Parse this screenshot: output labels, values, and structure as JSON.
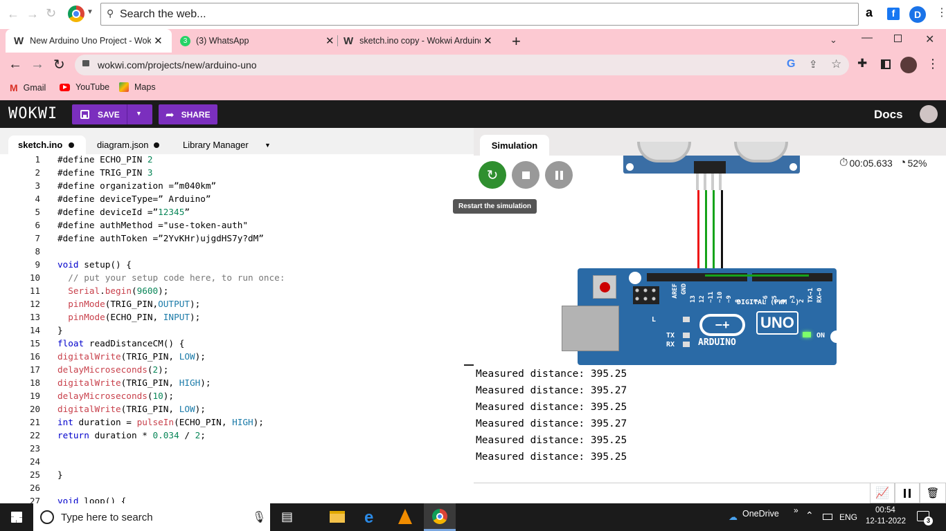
{
  "browser": {
    "search_placeholder": "Search the web...",
    "tabs": [
      {
        "title": "New Arduino Uno Project - Wokwi",
        "icon": "wokwi-icon"
      },
      {
        "title": "(3) WhatsApp",
        "icon": "whatsapp-icon"
      },
      {
        "title": "sketch.ino copy - Wokwi Arduino",
        "icon": "wokwi-icon"
      }
    ],
    "url": "wokwi.com/projects/new/arduino-uno",
    "bookmarks": [
      "Gmail",
      "YouTube",
      "Maps"
    ],
    "profile_letter": "D",
    "accent": "#fcc9d2"
  },
  "wokwi": {
    "logo": "WOKWI",
    "save_label": "SAVE",
    "share_label": "SHARE",
    "docs_label": "Docs"
  },
  "editor": {
    "tabs": [
      "sketch.ino",
      "diagram.json",
      "Library Manager"
    ],
    "lines": [
      "#define ECHO_PIN 2",
      "#define TRIG_PIN 3",
      "#define organization =”m040km”",
      "#define deviceType=” Arduino”",
      "#define deviceId =”12345”",
      "#define authMethod =\"use-token-auth\"",
      "#define authToken =”2YvKHr)ujgdHS7y?dM”",
      "",
      "void setup() {",
      "  // put your setup code here, to run once:",
      "  Serial.begin(9600);",
      "  pinMode(TRIG_PIN,OUTPUT);",
      "  pinMode(ECHO_PIN, INPUT);",
      "}",
      "float readDistanceCM() {",
      "digitalWrite(TRIG_PIN, LOW);",
      "delayMicroseconds(2);",
      "digitalWrite(TRIG_PIN, HIGH);",
      "delayMicroseconds(10);",
      "digitalWrite(TRIG_PIN, LOW);",
      "int duration = pulseIn(ECHO_PIN, HIGH);",
      "return duration * 0.034 / 2;",
      "",
      "",
      "}",
      "",
      "void loop() {"
    ]
  },
  "simulation": {
    "tab_label": "Simulation",
    "timer": "00:05.633",
    "speed": "52%",
    "tooltip": "Restart the simulation",
    "board_labels": {
      "uno": "UNO",
      "arduino": "ARDUINO",
      "on": "ON",
      "digital": "DIGITAL (PWM ~)",
      "tx": "TX",
      "rx": "RX",
      "l": "L",
      "aref": "AREF",
      "gnd": "GND",
      "pins": [
        "13",
        "12",
        "~11",
        "~10",
        "~9",
        "8",
        "7",
        "~6",
        "~5",
        "4",
        "~3",
        "2",
        "TX→1",
        "RX←0"
      ]
    }
  },
  "serial": {
    "lines": [
      "Measured distance: 395.25",
      "Measured distance: 395.27",
      "Measured distance: 395.25",
      "Measured distance: 395.27",
      "Measured distance: 395.25",
      "Measured distance: 395.25"
    ]
  },
  "taskbar": {
    "search_placeholder": "Type here to search",
    "onedrive": "OneDrive",
    "lang": "ENG",
    "time": "00:54",
    "date": "12-11-2022",
    "notif_count": "3"
  }
}
